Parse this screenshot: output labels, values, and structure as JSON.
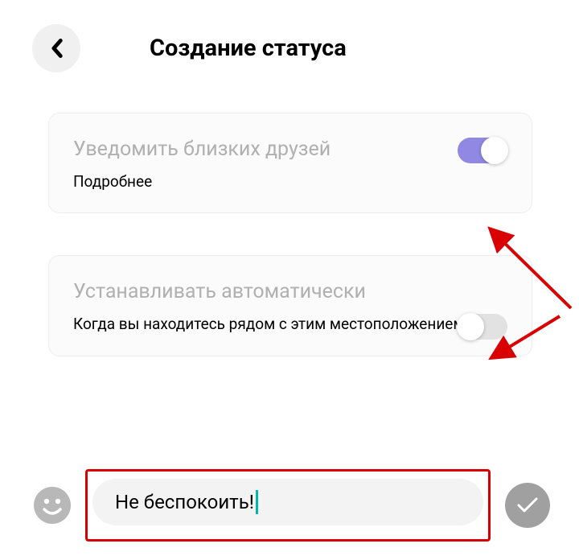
{
  "header": {
    "title": "Создание статуса"
  },
  "cards": {
    "notify": {
      "title": "Уведомить близких друзей",
      "sub": "Подробнее",
      "enabled": true
    },
    "auto": {
      "title": "Устанавливать автоматически",
      "sub": "Когда вы находитесь рядом с этим местоположением...",
      "enabled": false
    }
  },
  "input": {
    "value": "Не беспокоить!"
  }
}
